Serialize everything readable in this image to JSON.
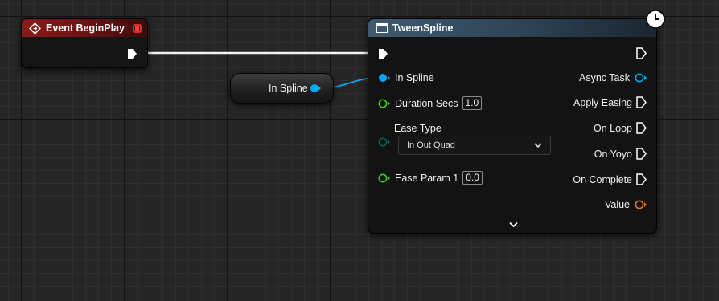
{
  "event_node": {
    "title": "Event BeginPlay",
    "header_color": "#8a1a1a"
  },
  "var_node": {
    "label": "In Spline",
    "pin_color": "#00a8f0"
  },
  "tween_node": {
    "title": "TweenSpline",
    "header_color": "#3f5a70",
    "inputs": {
      "in_spline": "In Spline",
      "duration_label": "Duration Secs",
      "duration_value": "1.0",
      "ease_type_label": "Ease Type",
      "ease_type_value": "In Out Quad",
      "ease_param_label": "Ease Param 1",
      "ease_param_value": "0.0"
    },
    "outputs": {
      "async_task": "Async Task",
      "apply_easing": "Apply Easing",
      "on_loop": "On Loop",
      "on_yoyo": "On Yoyo",
      "on_complete": "On Complete",
      "value": "Value"
    },
    "colors": {
      "object_pin": "#00a8f0",
      "float_pin": "#38d018",
      "enum_pin": "#00665c",
      "value_pin": "#e07b22"
    }
  }
}
